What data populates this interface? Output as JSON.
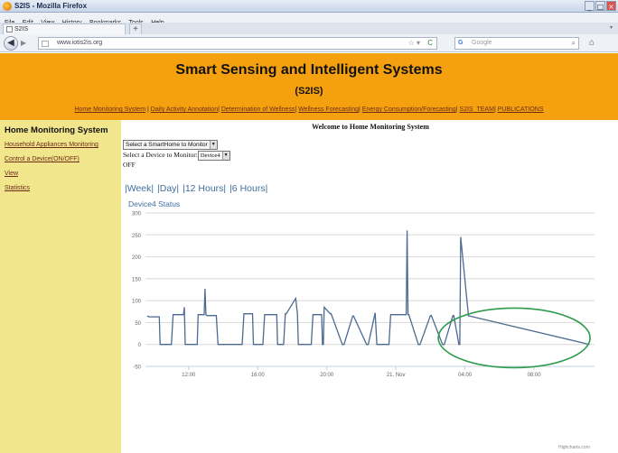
{
  "browser": {
    "window_title": "S2IS - Mozilla Firefox",
    "menu": [
      "File",
      "Edit",
      "View",
      "History",
      "Bookmarks",
      "Tools",
      "Help"
    ],
    "tab_label": "S2IS",
    "new_tab": "+",
    "url": "www.iotis2is.org",
    "search_placeholder": "Google",
    "search_engine": "G"
  },
  "banner": {
    "title": "Smart Sensing and Intelligent Systems",
    "subtitle": "(S2IS)",
    "bg_color": "#f5a10f",
    "links": [
      "Home Monitoring System",
      "Daily Activity Annotation",
      "Determination of Wellness",
      "Wellness Forecasting",
      "Energy Consumption/Forecasting",
      "S2IS_TEAM",
      "PUBLICATIONS"
    ]
  },
  "sidebar": {
    "heading": "Home Monitoring System",
    "items": [
      "Household Appliances Monitoring",
      "Control a Device(ON/OFF)",
      "View",
      "Statistics"
    ],
    "bg_color": "#f2e68c"
  },
  "main": {
    "welcome": "Welcome to Home Monitoring System",
    "select_home": "Select a SmartHome to Monitor",
    "select_device_label": "Select a Device to Monitor:",
    "select_device_value": "Device4",
    "state": "OFF",
    "ranges": [
      "|Week|",
      "|Day|",
      "|12 Hours|",
      "|6 Hours|"
    ]
  },
  "chart_data": {
    "type": "line",
    "title": "Device4 Status",
    "ylim": [
      -50,
      300
    ],
    "y_ticks": [
      -50,
      0,
      50,
      100,
      150,
      200,
      250,
      300
    ],
    "x_tick_labels": [
      "12:00",
      "16:00",
      "20:00",
      "21. Nov",
      "04:00",
      "08:00"
    ],
    "x_tick_hours": [
      12,
      16,
      20,
      24,
      28,
      32
    ],
    "xlim_hours": [
      9.5,
      35.5
    ],
    "grid": true,
    "credit": "Highcharts.com",
    "line_color": "#4c6a91",
    "highlight_color": "#2e9c4b",
    "series": [
      {
        "x": [
          9.6,
          9.7,
          10.3,
          10.35,
          10.4,
          11.0,
          11.1,
          11.7,
          11.75,
          11.8,
          11.9,
          12.5,
          12.55,
          12.9,
          12.95,
          13.0,
          13.05,
          13.6,
          13.7,
          14.3,
          14.35,
          14.6,
          14.65,
          15.1,
          15.2,
          15.7,
          15.75,
          16.3,
          16.4,
          17.1,
          17.15,
          17.5,
          17.6,
          17.65,
          18.2,
          18.3,
          18.35,
          18.4,
          19.1,
          19.2,
          19.7,
          19.75,
          19.8,
          19.85,
          20.2,
          20.25,
          20.9,
          21.0,
          21.5,
          21.55,
          22.3,
          22.4,
          22.8,
          22.9,
          23.6,
          23.7,
          24.6,
          24.65,
          24.7,
          24.75,
          25.3,
          25.4,
          26.0,
          26.05,
          26.7,
          26.8,
          27.3,
          27.35,
          27.65,
          27.7,
          27.75,
          28.2,
          28.25,
          35.2
        ],
        "y": [
          65,
          63,
          63,
          0,
          0,
          0,
          68,
          68,
          85,
          0,
          0,
          0,
          68,
          68,
          127,
          68,
          66,
          66,
          0,
          0,
          0,
          0,
          0,
          0,
          70,
          70,
          0,
          0,
          68,
          68,
          0,
          0,
          70,
          70,
          105,
          70,
          0,
          0,
          0,
          68,
          68,
          0,
          0,
          85,
          70,
          70,
          0,
          0,
          65,
          65,
          0,
          0,
          72,
          0,
          0,
          68,
          68,
          260,
          68,
          68,
          0,
          0,
          66,
          66,
          0,
          0,
          66,
          66,
          0,
          0,
          245,
          65,
          65,
          0
        ]
      }
    ]
  }
}
